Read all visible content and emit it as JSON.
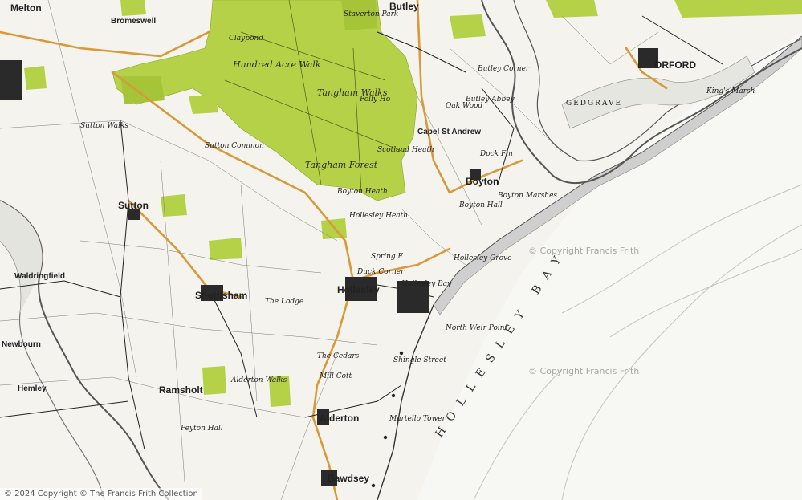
{
  "map": {
    "labels": {
      "melton": "Melton",
      "bromeswell": "Bromeswell",
      "sutton": "Sutton",
      "shottisham": "Shottisham",
      "ramsholt": "Ramsholt",
      "alderton": "Alderton",
      "bawdsey": "Bawdsey",
      "hollesley": "Hollesley",
      "boyton": "Boyton",
      "capel_st_andrew": "Capel St Andrew",
      "orford": "ORFORD",
      "butley": "Butley",
      "waldringfield": "Waldringfield",
      "newbourn": "Newbourn",
      "hemley": "Hemley",
      "hundred_acre_walk": "Hundred Acre Walk",
      "tangham_walks": "Tangham Walks",
      "tangham_forest": "Tangham Forest",
      "staverton_park": "Staverton Park",
      "hollesley_heath": "Hollesley Heath",
      "boyton_heath": "Boyton Heath",
      "sutton_walks": "Sutton Walks",
      "sutton_common": "Sutton Common",
      "alderton_walks": "Alderton Walks",
      "the_cedars": "The Cedars",
      "martello_tower": "Martello Tower",
      "north_weir_point": "North Weir Point",
      "hollesley_bay_label": "Hollesley Bay",
      "duck_corner": "Duck Corner",
      "the_lodge": "The Lodge",
      "gedgrave": "GEDGRAVE",
      "kings_marsh": "King's Marsh",
      "boyton_marshes": "Boyton Marshes",
      "oak_wood": "Oak Wood",
      "scotland_heath": "Scotland Heath",
      "butley_abbey": "Butley Abbey",
      "butley_corner": "Butley Corner",
      "claypond": "Claypond",
      "folly_ho": "Folly Ho",
      "spring_fm": "Spring F",
      "mill_cott": "Mill Cott",
      "peyton_hall": "Peyton Hall",
      "shingle_street": "Shingle Street",
      "hollesley_grove": "Hollesley Grove",
      "boyton_hall": "Boyton Hall",
      "dock_fm": "Dock Fm"
    },
    "bay_name": "HOLLESLEY BAY",
    "watermark": "© Copyright Francis Frith",
    "footer": "© 2024 Copyright © The Francis Frith Collection"
  },
  "colors": {
    "paper": "#f4f3ee",
    "forest": "#b5d148",
    "forest_dark": "#a5c438",
    "road": "#d79a3a",
    "road_minor": "#222222",
    "water_lines": "#b8b8b8",
    "coast": "#333333"
  }
}
